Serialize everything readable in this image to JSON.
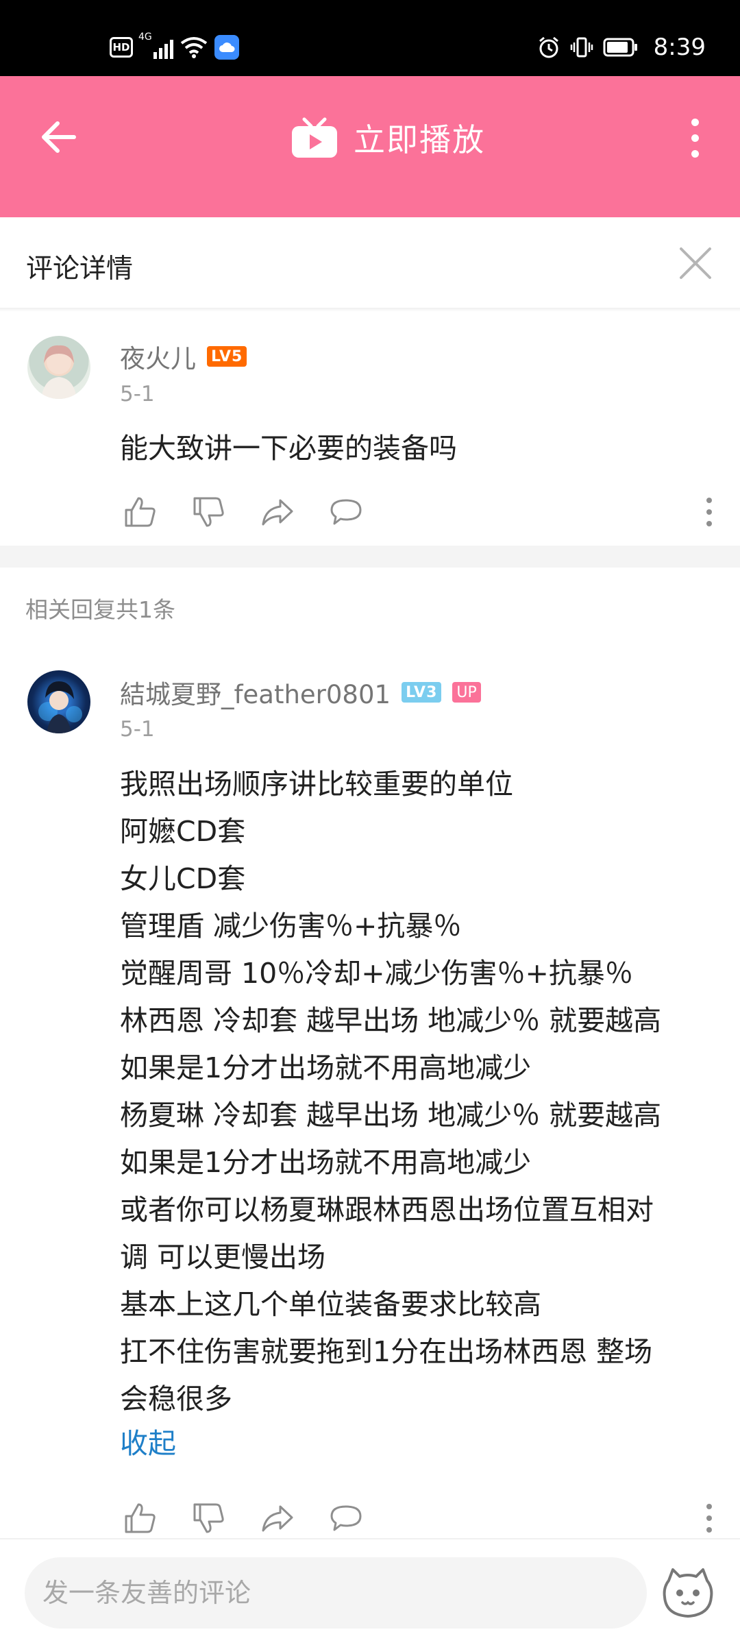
{
  "status_bar": {
    "hd": "HD",
    "network": "4G",
    "time": "8:39"
  },
  "app_bar": {
    "back_icon": "arrow-left-icon",
    "tv_icon": "tv-icon",
    "title": "立即播放",
    "more_icon": "more-vertical-icon",
    "color": "#fb7299"
  },
  "detail_header": {
    "title": "评论详情",
    "close_icon": "close-icon"
  },
  "main_comment": {
    "username": "夜火儿",
    "level": "LV5",
    "date": "5-1",
    "text": "能大致讲一下必要的装备吗"
  },
  "replies": {
    "count_label": "相关回复共1条",
    "items": [
      {
        "username": "結城夏野_feather0801",
        "level": "LV3",
        "up_badge": "UP",
        "date": "5-1",
        "lines": [
          "我照出场顺序讲比较重要的单位",
          "阿嬷CD套",
          "女儿CD套",
          "管理盾 减少伤害％+抗暴％",
          "觉醒周哥 10％冷却+减少伤害％+抗暴％",
          "林西恩 冷却套 越早出场 地减少％ 就要越高",
          "如果是1分才出场就不用高地减少",
          "杨夏琳 冷却套 越早出场 地减少％ 就要越高",
          "如果是1分才出场就不用高地减少",
          "或者你可以杨夏琳跟林西恩出场位置互相对",
          "调 可以更慢出场",
          "基本上这几个单位装备要求比较高",
          "扛不住伤害就要拖到1分在出场林西恩 整场",
          "会稳很多"
        ],
        "collapse_label": "收起"
      }
    ]
  },
  "actions": {
    "like_icon": "thumbs-up-icon",
    "dislike_icon": "thumbs-down-icon",
    "share_icon": "share-icon",
    "reply_icon": "chat-bubble-icon",
    "more_icon": "more-vertical-icon"
  },
  "bottom_bar": {
    "placeholder": "发一条友善的评论",
    "emoji_icon": "emoji-icon"
  }
}
